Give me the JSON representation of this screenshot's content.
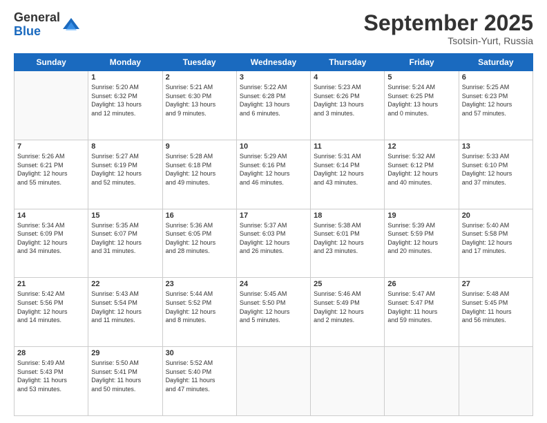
{
  "logo": {
    "general": "General",
    "blue": "Blue"
  },
  "header": {
    "month": "September 2025",
    "location": "Tsotsin-Yurt, Russia"
  },
  "weekdays": [
    "Sunday",
    "Monday",
    "Tuesday",
    "Wednesday",
    "Thursday",
    "Friday",
    "Saturday"
  ],
  "weeks": [
    [
      {
        "day": "",
        "info": ""
      },
      {
        "day": "1",
        "info": "Sunrise: 5:20 AM\nSunset: 6:32 PM\nDaylight: 13 hours\nand 12 minutes."
      },
      {
        "day": "2",
        "info": "Sunrise: 5:21 AM\nSunset: 6:30 PM\nDaylight: 13 hours\nand 9 minutes."
      },
      {
        "day": "3",
        "info": "Sunrise: 5:22 AM\nSunset: 6:28 PM\nDaylight: 13 hours\nand 6 minutes."
      },
      {
        "day": "4",
        "info": "Sunrise: 5:23 AM\nSunset: 6:26 PM\nDaylight: 13 hours\nand 3 minutes."
      },
      {
        "day": "5",
        "info": "Sunrise: 5:24 AM\nSunset: 6:25 PM\nDaylight: 13 hours\nand 0 minutes."
      },
      {
        "day": "6",
        "info": "Sunrise: 5:25 AM\nSunset: 6:23 PM\nDaylight: 12 hours\nand 57 minutes."
      }
    ],
    [
      {
        "day": "7",
        "info": "Sunrise: 5:26 AM\nSunset: 6:21 PM\nDaylight: 12 hours\nand 55 minutes."
      },
      {
        "day": "8",
        "info": "Sunrise: 5:27 AM\nSunset: 6:19 PM\nDaylight: 12 hours\nand 52 minutes."
      },
      {
        "day": "9",
        "info": "Sunrise: 5:28 AM\nSunset: 6:18 PM\nDaylight: 12 hours\nand 49 minutes."
      },
      {
        "day": "10",
        "info": "Sunrise: 5:29 AM\nSunset: 6:16 PM\nDaylight: 12 hours\nand 46 minutes."
      },
      {
        "day": "11",
        "info": "Sunrise: 5:31 AM\nSunset: 6:14 PM\nDaylight: 12 hours\nand 43 minutes."
      },
      {
        "day": "12",
        "info": "Sunrise: 5:32 AM\nSunset: 6:12 PM\nDaylight: 12 hours\nand 40 minutes."
      },
      {
        "day": "13",
        "info": "Sunrise: 5:33 AM\nSunset: 6:10 PM\nDaylight: 12 hours\nand 37 minutes."
      }
    ],
    [
      {
        "day": "14",
        "info": "Sunrise: 5:34 AM\nSunset: 6:09 PM\nDaylight: 12 hours\nand 34 minutes."
      },
      {
        "day": "15",
        "info": "Sunrise: 5:35 AM\nSunset: 6:07 PM\nDaylight: 12 hours\nand 31 minutes."
      },
      {
        "day": "16",
        "info": "Sunrise: 5:36 AM\nSunset: 6:05 PM\nDaylight: 12 hours\nand 28 minutes."
      },
      {
        "day": "17",
        "info": "Sunrise: 5:37 AM\nSunset: 6:03 PM\nDaylight: 12 hours\nand 26 minutes."
      },
      {
        "day": "18",
        "info": "Sunrise: 5:38 AM\nSunset: 6:01 PM\nDaylight: 12 hours\nand 23 minutes."
      },
      {
        "day": "19",
        "info": "Sunrise: 5:39 AM\nSunset: 5:59 PM\nDaylight: 12 hours\nand 20 minutes."
      },
      {
        "day": "20",
        "info": "Sunrise: 5:40 AM\nSunset: 5:58 PM\nDaylight: 12 hours\nand 17 minutes."
      }
    ],
    [
      {
        "day": "21",
        "info": "Sunrise: 5:42 AM\nSunset: 5:56 PM\nDaylight: 12 hours\nand 14 minutes."
      },
      {
        "day": "22",
        "info": "Sunrise: 5:43 AM\nSunset: 5:54 PM\nDaylight: 12 hours\nand 11 minutes."
      },
      {
        "day": "23",
        "info": "Sunrise: 5:44 AM\nSunset: 5:52 PM\nDaylight: 12 hours\nand 8 minutes."
      },
      {
        "day": "24",
        "info": "Sunrise: 5:45 AM\nSunset: 5:50 PM\nDaylight: 12 hours\nand 5 minutes."
      },
      {
        "day": "25",
        "info": "Sunrise: 5:46 AM\nSunset: 5:49 PM\nDaylight: 12 hours\nand 2 minutes."
      },
      {
        "day": "26",
        "info": "Sunrise: 5:47 AM\nSunset: 5:47 PM\nDaylight: 11 hours\nand 59 minutes."
      },
      {
        "day": "27",
        "info": "Sunrise: 5:48 AM\nSunset: 5:45 PM\nDaylight: 11 hours\nand 56 minutes."
      }
    ],
    [
      {
        "day": "28",
        "info": "Sunrise: 5:49 AM\nSunset: 5:43 PM\nDaylight: 11 hours\nand 53 minutes."
      },
      {
        "day": "29",
        "info": "Sunrise: 5:50 AM\nSunset: 5:41 PM\nDaylight: 11 hours\nand 50 minutes."
      },
      {
        "day": "30",
        "info": "Sunrise: 5:52 AM\nSunset: 5:40 PM\nDaylight: 11 hours\nand 47 minutes."
      },
      {
        "day": "",
        "info": ""
      },
      {
        "day": "",
        "info": ""
      },
      {
        "day": "",
        "info": ""
      },
      {
        "day": "",
        "info": ""
      }
    ]
  ]
}
